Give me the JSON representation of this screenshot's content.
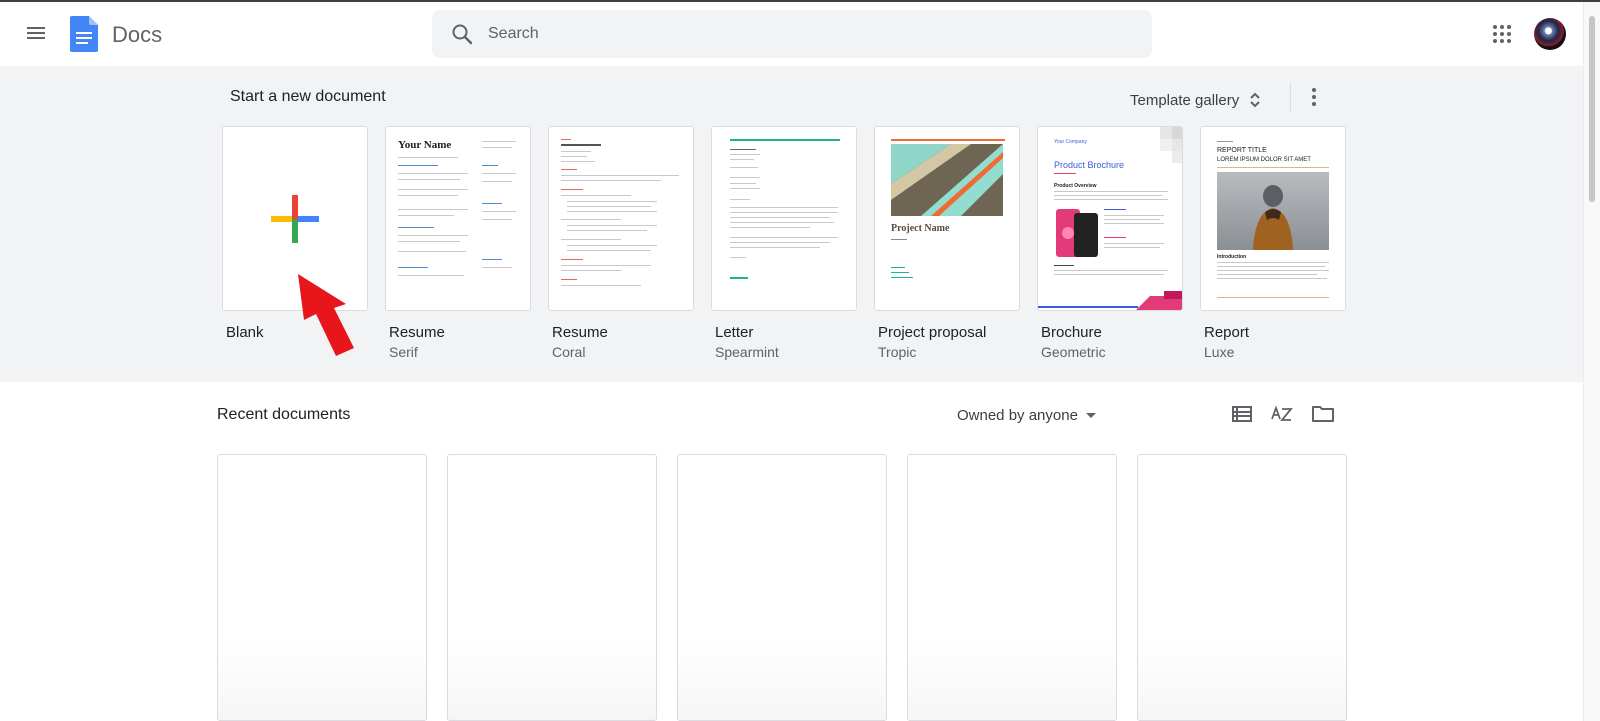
{
  "app": {
    "title": "Docs"
  },
  "search": {
    "placeholder": "Search"
  },
  "new_doc": {
    "title": "Start a new document",
    "gallery_label": "Template gallery",
    "templates": [
      {
        "name": "Blank",
        "sub": ""
      },
      {
        "name": "Resume",
        "sub": "Serif"
      },
      {
        "name": "Resume",
        "sub": "Coral"
      },
      {
        "name": "Letter",
        "sub": "Spearmint"
      },
      {
        "name": "Project proposal",
        "sub": "Tropic"
      },
      {
        "name": "Brochure",
        "sub": "Geometric"
      },
      {
        "name": "Report",
        "sub": "Luxe"
      }
    ],
    "thumb_text": {
      "resume_serif": "Your Name",
      "proposal": "Project Name",
      "brochure_company": "Your Company",
      "brochure_title": "Product Brochure",
      "brochure_section": "Product Overview",
      "report_title": "REPORT TITLE",
      "report_sub": "LOREM IPSUM DOLOR SIT AMET",
      "report_intro": "Introduction"
    }
  },
  "recent": {
    "title": "Recent documents",
    "owner_filter": "Owned by anyone"
  },
  "colors": {
    "google_blue": "#4285f4",
    "google_red": "#ea4335",
    "google_yellow": "#fbbc04",
    "google_green": "#34a853",
    "section_bg": "#f1f3f4",
    "arrow_red": "#e8151b"
  }
}
